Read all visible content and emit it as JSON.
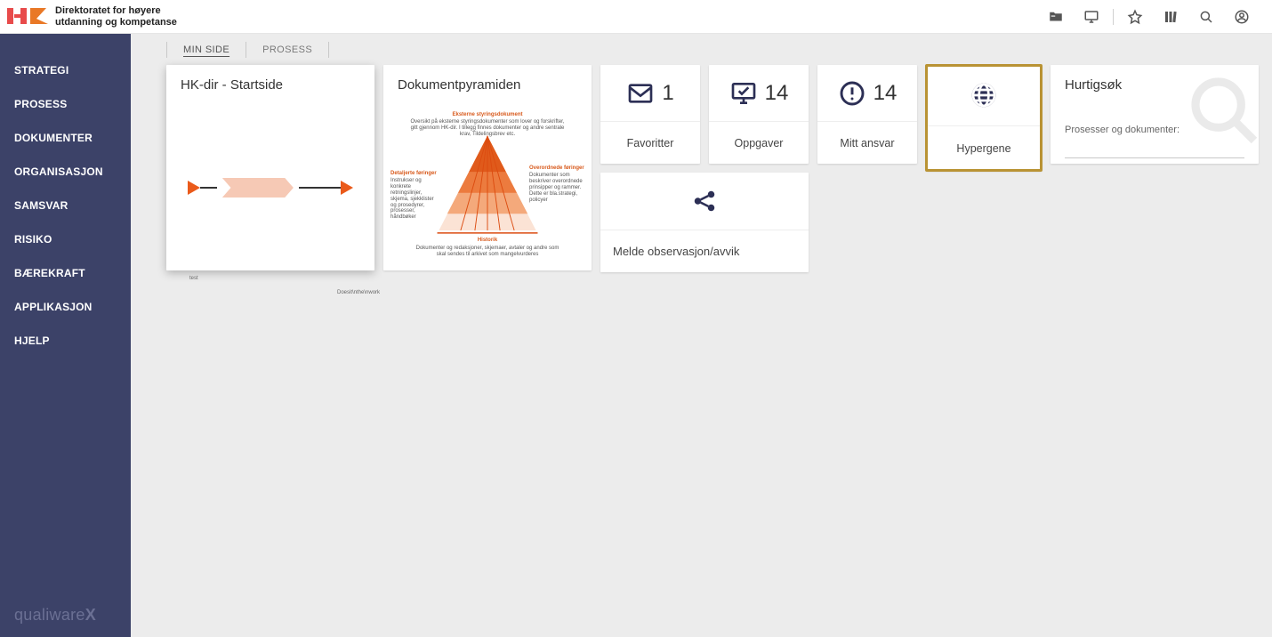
{
  "header": {
    "org_line1": "Direktoratet for høyere",
    "org_line2": "utdanning og kompetanse",
    "icons": [
      "folder-icon",
      "monitor-icon",
      "star-icon",
      "library-icon",
      "search-icon",
      "account-icon"
    ]
  },
  "sidebar": {
    "items": [
      {
        "label": "STRATEGI"
      },
      {
        "label": "PROSESS"
      },
      {
        "label": "DOKUMENTER"
      },
      {
        "label": "ORGANISASJON"
      },
      {
        "label": "SAMSVAR"
      },
      {
        "label": "RISIKO"
      },
      {
        "label": "BÆREKRAFT"
      },
      {
        "label": "APPLIKASJON"
      },
      {
        "label": "HJELP"
      }
    ],
    "footer_brand": "qualiware",
    "footer_brand_x": "X"
  },
  "tabs": {
    "active": "MIN SIDE",
    "other": "PROSESS"
  },
  "cards": {
    "start": {
      "title": "HK-dir - Startside",
      "proc_label_left": "test",
      "proc_label_right": "Doesit\\nthe\\nwork"
    },
    "pyramid": {
      "title": "Dokumentpyramiden",
      "top_label": "Eksterne styringsdokument",
      "top_sub": "Oversikt på eksterne styringsdokumenter som lover og forskrifter, gitt gjennom HK-dir. I tillegg finnes dokumenter og andre sentrale krav, Tildelingsbrev etc.",
      "left_label": "Detaljerte føringer",
      "left_sub": "Instrukser og konkrete retningslinjer, skjema, sjekklister og prosedyrer, prosesser, håndbøker",
      "right_label": "Overordnede føringer",
      "right_sub": "Dokumenter som beskriver overordnede prinsipper og rammer. Dette er bla.strategi, policyer",
      "bottom_label": "Historik",
      "bottom_sub": "Dokumenter og redaksjoner, skjemaer, avtaler og andre som skal sendes til arkivet som mangelvurderes"
    },
    "metrics": {
      "favoritter": {
        "count": "1",
        "label": "Favoritter"
      },
      "oppgaver": {
        "count": "14",
        "label": "Oppgaver"
      },
      "mitt_ansvar": {
        "count": "14",
        "label": "Mitt ansvar"
      },
      "hypergene": {
        "label": "Hypergene"
      },
      "melde": {
        "label": "Melde observasjon/avvik"
      }
    },
    "search": {
      "title": "Hurtigsøk",
      "label": "Prosesser og dokumenter:",
      "value": ""
    }
  }
}
